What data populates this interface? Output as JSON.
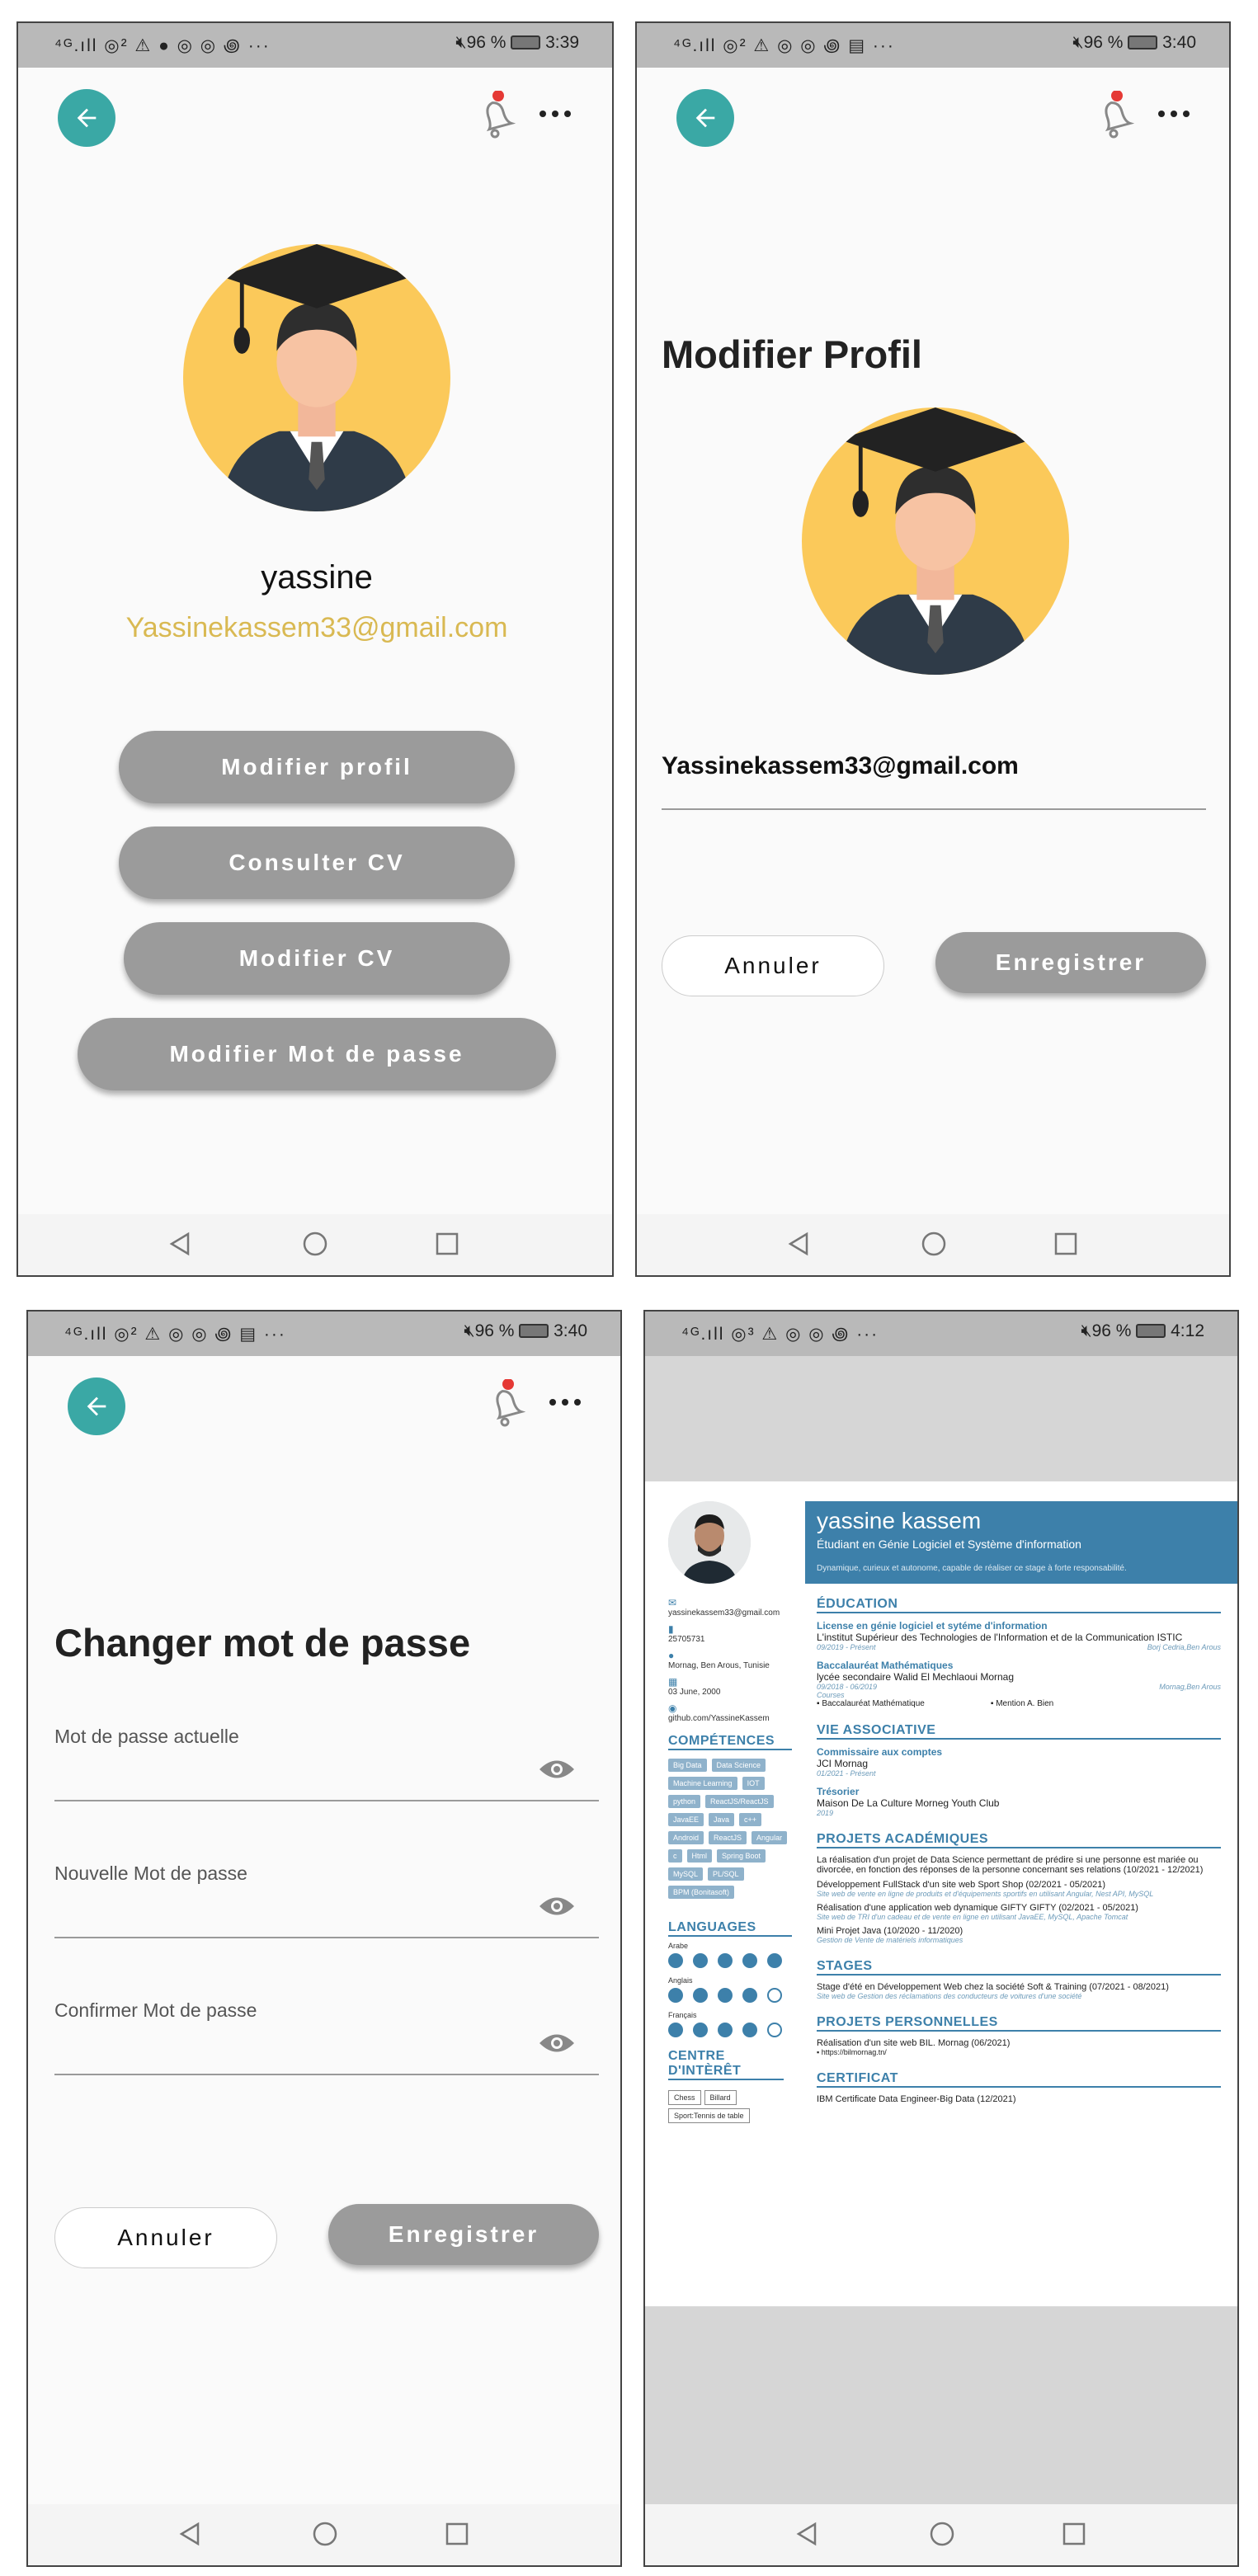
{
  "statusbar": {
    "p1": {
      "left": "⁴ᴳ.ıll ◎² ⚠ ● ◎ ◎ ꩜ ···",
      "right_batt": "96 %",
      "time": "3:39"
    },
    "p2": {
      "left": "⁴ᴳ.ıll ◎² ⚠ ◎ ◎ ꩜ ▤ ···",
      "right_batt": "96 %",
      "time": "3:40"
    },
    "p3": {
      "left": "⁴ᴳ.ıll ◎² ⚠ ◎ ◎ ꩜ ▤ ···",
      "right_batt": "96 %",
      "time": "3:40"
    },
    "p4": {
      "left": "⁴ᴳ.ıll ◎³ ⚠ ◎ ◎ ꩜ ···",
      "right_batt": "96 %",
      "time": "4:12"
    }
  },
  "profile": {
    "name": "yassine",
    "email": "Yassinekassem33@gmail.com",
    "buttons": {
      "edit_profile": "Modifier profil",
      "view_cv": "Consulter CV",
      "edit_cv": "Modifier CV",
      "change_password": "Modifier Mot de passe"
    }
  },
  "edit_profile": {
    "title": "Modifier Profil",
    "email": "Yassinekassem33@gmail.com",
    "cancel": "Annuler",
    "save": "Enregistrer"
  },
  "change_password": {
    "title": "Changer mot de passe",
    "current_label": "Mot de passe actuelle",
    "new_label": "Nouvelle Mot de passe",
    "confirm_label": "Confirmer Mot de passe",
    "cancel": "Annuler",
    "save": "Enregistrer"
  },
  "cv": {
    "name": "yassine kassem",
    "subtitle": "Étudiant en Génie Logiciel et Système d'information",
    "tagline": "Dynamique, curieux et autonome, capable de réaliser ce stage à forte responsabilité.",
    "contact": {
      "email": "yassinekassem33@gmail.com",
      "phone": "25705731",
      "location": "Mornag, Ben Arous, Tunisie",
      "birth": "03 June, 2000",
      "github": "github.com/YassineKassem"
    },
    "skills_title": "COMPÉTENCES",
    "skills": [
      "Big Data",
      "Data Science",
      "Machine Learning",
      "IOT",
      "python",
      "ReactJS/ReactJS",
      "JavaEE",
      "Java",
      "c++",
      "Android",
      "ReactJS",
      "Angular",
      "c",
      "Html",
      "Spring Boot",
      "MySQL",
      "PL/SQL",
      "BPM (Bonitasoft)"
    ],
    "languages_title": "LANGUAGES",
    "languages": [
      {
        "name": "Arabe",
        "level": 5
      },
      {
        "name": "Anglais",
        "level": 4
      },
      {
        "name": "Français",
        "level": 4
      }
    ],
    "interests_title": "CENTRE D'INTÈRÊT",
    "interests": [
      "Chess",
      "Billard",
      "Sport:Tennis de table"
    ],
    "education_title": "ÉDUCATION",
    "edu1_title": "License en génie logiciel et sytéme d'information",
    "edu1_school": "L'institut Supérieur des Technologies de l'Information et de la Communication ISTIC",
    "edu1_date": "09/2019 - Présent",
    "edu1_place": "Borj Cedria,Ben Arous",
    "edu2_title": "Baccalauréat Mathématiques",
    "edu2_school": "lycée secondaire Walid El Mechlaoui Mornag",
    "edu2_date": "09/2018 - 06/2019",
    "edu2_place": "Mornag,Ben Arous",
    "edu2_courses": "Courses",
    "edu2_c1": "Baccalauréat Mathématique",
    "edu2_c2": "Mention A. Bien",
    "assoc_title": "VIE ASSOCIATIVE",
    "assoc1_title": "Commissaire aux comptes",
    "assoc1_org": "JCI Mornag",
    "assoc1_date": "01/2021 - Présent",
    "assoc2_title": "Trésorier",
    "assoc2_org": "Maison De La Culture Morneg Youth Club",
    "assoc2_date": "2019",
    "proj_title": "PROJETS ACADÉMIQUES",
    "proj1": "La réalisation d'un projet de Data Science permettant de prédire si une personne est mariée ou divorcée, en fonction des réponses de la personne concernant ses relations (10/2021 - 12/2021)",
    "proj2": "Développement FullStack d'un site web Sport Shop (02/2021 - 05/2021)",
    "proj2_sub": "Site web de vente en ligne de produits et d'équipements sportifs en utilisant Angular, Nest API, MySQL",
    "proj3": "Réalisation d'une application web dynamique GIFTY GIFTY (02/2021 - 05/2021)",
    "proj3_sub": "Site web de TRI d'un cadeau et de vente en ligne en utilisant JavaEE, MySQL, Apache Tomcat",
    "proj4": "Mini Projet Java (10/2020 - 11/2020)",
    "proj4_sub": "Gestion de Vente de matériels informatiques",
    "stages_title": "STAGES",
    "stage1": "Stage d'été en Développement Web chez la société Soft & Training (07/2021 - 08/2021)",
    "stage1_sub": "Site web de Gestion des réclamations des conducteurs de voitures d'une société",
    "perso_title": "PROJETS PERSONNELLES",
    "perso1": "Réalisation d'un site web BIL. Mornag (06/2021)",
    "perso1_link": "https://bilmornag.tn/",
    "cert_title": "CERTIFICAT",
    "cert1": "IBM Certificate Data Engineer-Big Data (12/2021)"
  },
  "colors": {
    "accent": "#3aa8a5",
    "button_gray": "#9b9b9b",
    "email_gold": "#d9b952",
    "cv_blue": "#3d80aa",
    "notif_red": "#e53935"
  },
  "icons": [
    "back-arrow-icon",
    "bell-icon",
    "more-icon",
    "eye-icon",
    "nav-back-icon",
    "nav-home-icon",
    "nav-recent-icon"
  ]
}
